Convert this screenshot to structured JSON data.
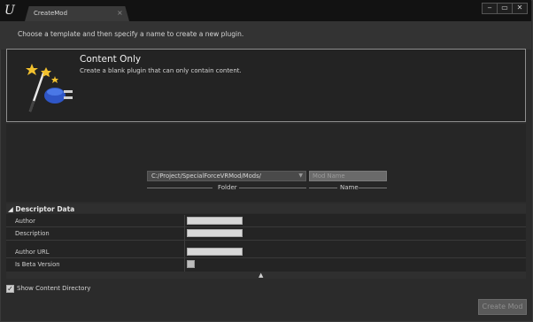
{
  "window": {
    "tab_title": "CreateMod",
    "tab_close": "×",
    "buttons": {
      "minimize": "‒",
      "maximize": "▭",
      "close": "✕"
    }
  },
  "instructions": "Choose a template and then specify a name to create a new plugin.",
  "template": {
    "title": "Content Only",
    "description": "Create a blank plugin that can only contain content.",
    "icon": "magic-wand-stars-icon"
  },
  "path": {
    "folder_value": "C:/Project/SpecialForceVRMod/Mods/",
    "folder_label": "Folder",
    "name_placeholder": "Mod Name",
    "name_label": "Name"
  },
  "descriptor": {
    "title": "Descriptor Data",
    "fields": [
      {
        "label": "Author",
        "value": ""
      },
      {
        "label": "Description",
        "value": ""
      },
      {
        "label": "Author URL",
        "value": ""
      },
      {
        "label": "Is Beta Version",
        "checked": false
      }
    ]
  },
  "footer": {
    "show_content_directory_label": "Show Content Directory",
    "show_content_directory_checked": true,
    "create_button": "Create Mod"
  }
}
